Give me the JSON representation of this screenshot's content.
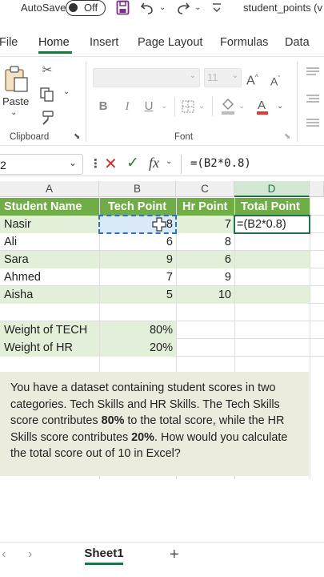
{
  "titlebar": {
    "autosave_label": "AutoSave",
    "autosave_state": "Off",
    "filename": "student_points (v"
  },
  "ribbon_tabs": [
    "File",
    "Home",
    "Insert",
    "Page Layout",
    "Formulas",
    "Data"
  ],
  "ribbon": {
    "paste_label": "Paste",
    "clipboard_label": "Clipboard",
    "font_label": "Font",
    "font_size": "11",
    "bold": "B",
    "italic": "I",
    "underline": "U"
  },
  "formula_bar": {
    "name_box": "2",
    "fx": "fx",
    "formula": "=(B2*0.8)"
  },
  "columns": [
    "A",
    "B",
    "C",
    "D"
  ],
  "table": {
    "headers": [
      "Student Name",
      "Tech Point",
      "Hr Point",
      "Total Point"
    ],
    "rows": [
      {
        "name": "Nasir",
        "tech": "8",
        "hr": "7",
        "total": "=(B2*0.8)"
      },
      {
        "name": "Ali",
        "tech": "6",
        "hr": "8",
        "total": ""
      },
      {
        "name": "Sara",
        "tech": "9",
        "hr": "6",
        "total": ""
      },
      {
        "name": "Ahmed",
        "tech": "7",
        "hr": "9",
        "total": ""
      },
      {
        "name": "Aisha",
        "tech": "5",
        "hr": "10",
        "total": ""
      }
    ]
  },
  "weights": [
    {
      "label": "Weight of TECH",
      "value": "80%"
    },
    {
      "label": "Weight of HR",
      "value": "20%"
    }
  ],
  "question": {
    "part1": "You have a dataset containing student scores in two categories. Tech Skills and HR Skills. The Tech Skills score contributes ",
    "bold1": "80%",
    "part2": " to the total score, while the HR Skills score contributes ",
    "bold2": "20%",
    "part3": ". How would you calculate the total score out of 10 in Excel?"
  },
  "sheet_tab": "Sheet1",
  "colors": {
    "accent": "#217346",
    "header_green": "#70ad47",
    "light_green": "#e2efd9",
    "question_bg": "#ececde"
  }
}
